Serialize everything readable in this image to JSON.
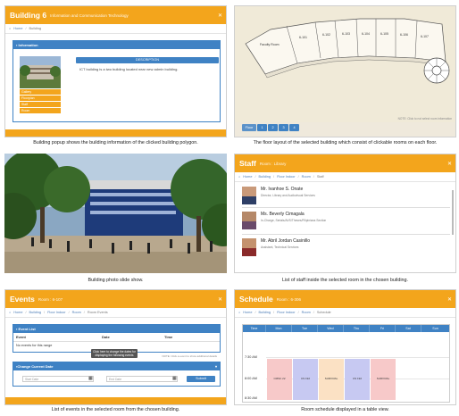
{
  "panels": {
    "building": {
      "title": "Building 6",
      "subtitle": "Information and Communication Technology",
      "crumbs": [
        "Home",
        "Building"
      ],
      "info_header": "Information",
      "description_label": "DESCRIPTION",
      "description": "ICT building is a two building located near new admin building.",
      "menu": [
        "Gallery",
        "Floorplan",
        "Staff",
        "Room"
      ],
      "caption": "Building popup shows the building information of the clicked building polygon."
    },
    "floor": {
      "rooms": [
        "Faculty Room",
        "6-101",
        "6-102",
        "6-103",
        "6-104",
        "6-105",
        "6-106",
        "6-107"
      ],
      "tabs": [
        "Floor",
        "1",
        "2",
        "3",
        "4"
      ],
      "note": "NOTE: Click to not select room information",
      "caption": "The floor layout of the selected building which consist of clickable rooms on each floor."
    },
    "photo": {
      "caption": "Building photo slide show."
    },
    "staff": {
      "title": "Staff",
      "subtitle": "Room : Library",
      "crumbs": [
        "Home",
        "Building",
        "Floor Indoor",
        "Room",
        "Staff"
      ],
      "people": [
        {
          "name": "Mr. Ivanhoe S. Onate",
          "role": "Director, Library and Audiovisual Services"
        },
        {
          "name": "Ms. Beverly Cimagala",
          "role": "In-Charge, Serials/AVS/Theses/Filipiniana Section"
        },
        {
          "name": "Mr. Abril Jordan Casinillo",
          "role": "Assistant, Technical Services"
        }
      ],
      "caption": "List of staff inside the selected room in the chosen building."
    },
    "events": {
      "title": "Events",
      "subtitle": "Room : 6-107",
      "crumbs": [
        "Home",
        "Building",
        "Floor Indoor",
        "Room",
        "Room Events"
      ],
      "list_header": "Event List",
      "columns": [
        "Event",
        "Date",
        "Time"
      ],
      "empty": "No events for this range",
      "tooltip": "Click here to change the dates for displaying the following events",
      "note": "NOTE: Click a event to show additional details",
      "change_header": "Change Current Date",
      "start_placeholder": "Start Date",
      "end_placeholder": "End Date",
      "submit": "Submit",
      "caption": "List of events in the selected room from the chosen building."
    },
    "schedule": {
      "title": "Schedule",
      "subtitle": "Room : 6-306",
      "crumbs": [
        "Home",
        "Building",
        "Floor Indoor",
        "Room",
        "Schedule"
      ],
      "days": [
        "Time",
        "Mon",
        "Tue",
        "Wed",
        "Thu",
        "Fri",
        "Sat",
        "Sun"
      ],
      "times": [
        "7:30 AM",
        "8:00 AM",
        "8:30 AM"
      ],
      "classes": [
        {
          "day": "Mon",
          "code": "CMSC 22",
          "color": "#f7c9c9"
        },
        {
          "day": "Tue",
          "code": "CS 192",
          "color": "#c7c9f2"
        },
        {
          "day": "Wed",
          "code": "SURVIVAL",
          "color": "#fbe1c4"
        },
        {
          "day": "Thu",
          "code": "CS 192",
          "color": "#c7c9f2"
        },
        {
          "day": "Fri",
          "code": "SURVIVAL",
          "color": "#f7c9c9"
        }
      ],
      "caption": "Room schedule displayed in a table view."
    }
  }
}
